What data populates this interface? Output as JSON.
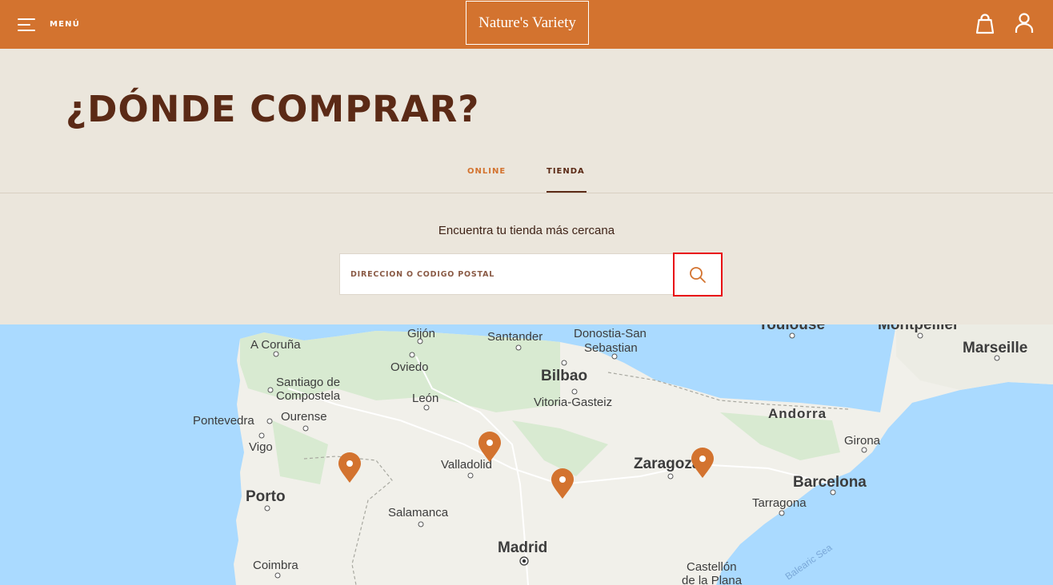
{
  "header": {
    "menu_label": "MENÚ",
    "logo_text": "Nature's Variety",
    "brand_color": "#d3732f",
    "icons": [
      "menu-icon",
      "bag-icon",
      "user-icon"
    ]
  },
  "hero": {
    "title": "¿DÓNDE COMPRAR?"
  },
  "tabs": [
    {
      "label": "ONLINE",
      "active": false
    },
    {
      "label": "TIENDA",
      "active": true
    }
  ],
  "search": {
    "heading": "Encuentra tu tienda más cercana",
    "placeholder": "DIRECCIÓN O CÓDIGO POSTAL",
    "value": "",
    "button_icon": "search-icon"
  },
  "map": {
    "cities": [
      "Gijón",
      "Santander",
      "Donostia-San",
      "Sebastian",
      "Toulouse",
      "Montpellier",
      "A Coruña",
      "Marseille",
      "Oviedo",
      "Bilbao",
      "Santiago de",
      "Compostela",
      "León",
      "Vitoria-Gasteiz",
      "Andorra",
      "Pontevedra",
      "Ourense",
      "Vigo",
      "Girona",
      "Valladolid",
      "Zaragoza",
      "Barcelona",
      "Porto",
      "Tarragona",
      "Salamanca",
      "Madrid",
      "Coimbra",
      "Castellón",
      "de la Plana",
      "Balearic Sea"
    ],
    "store_markers": 4,
    "marker_color": "#d3732f"
  }
}
